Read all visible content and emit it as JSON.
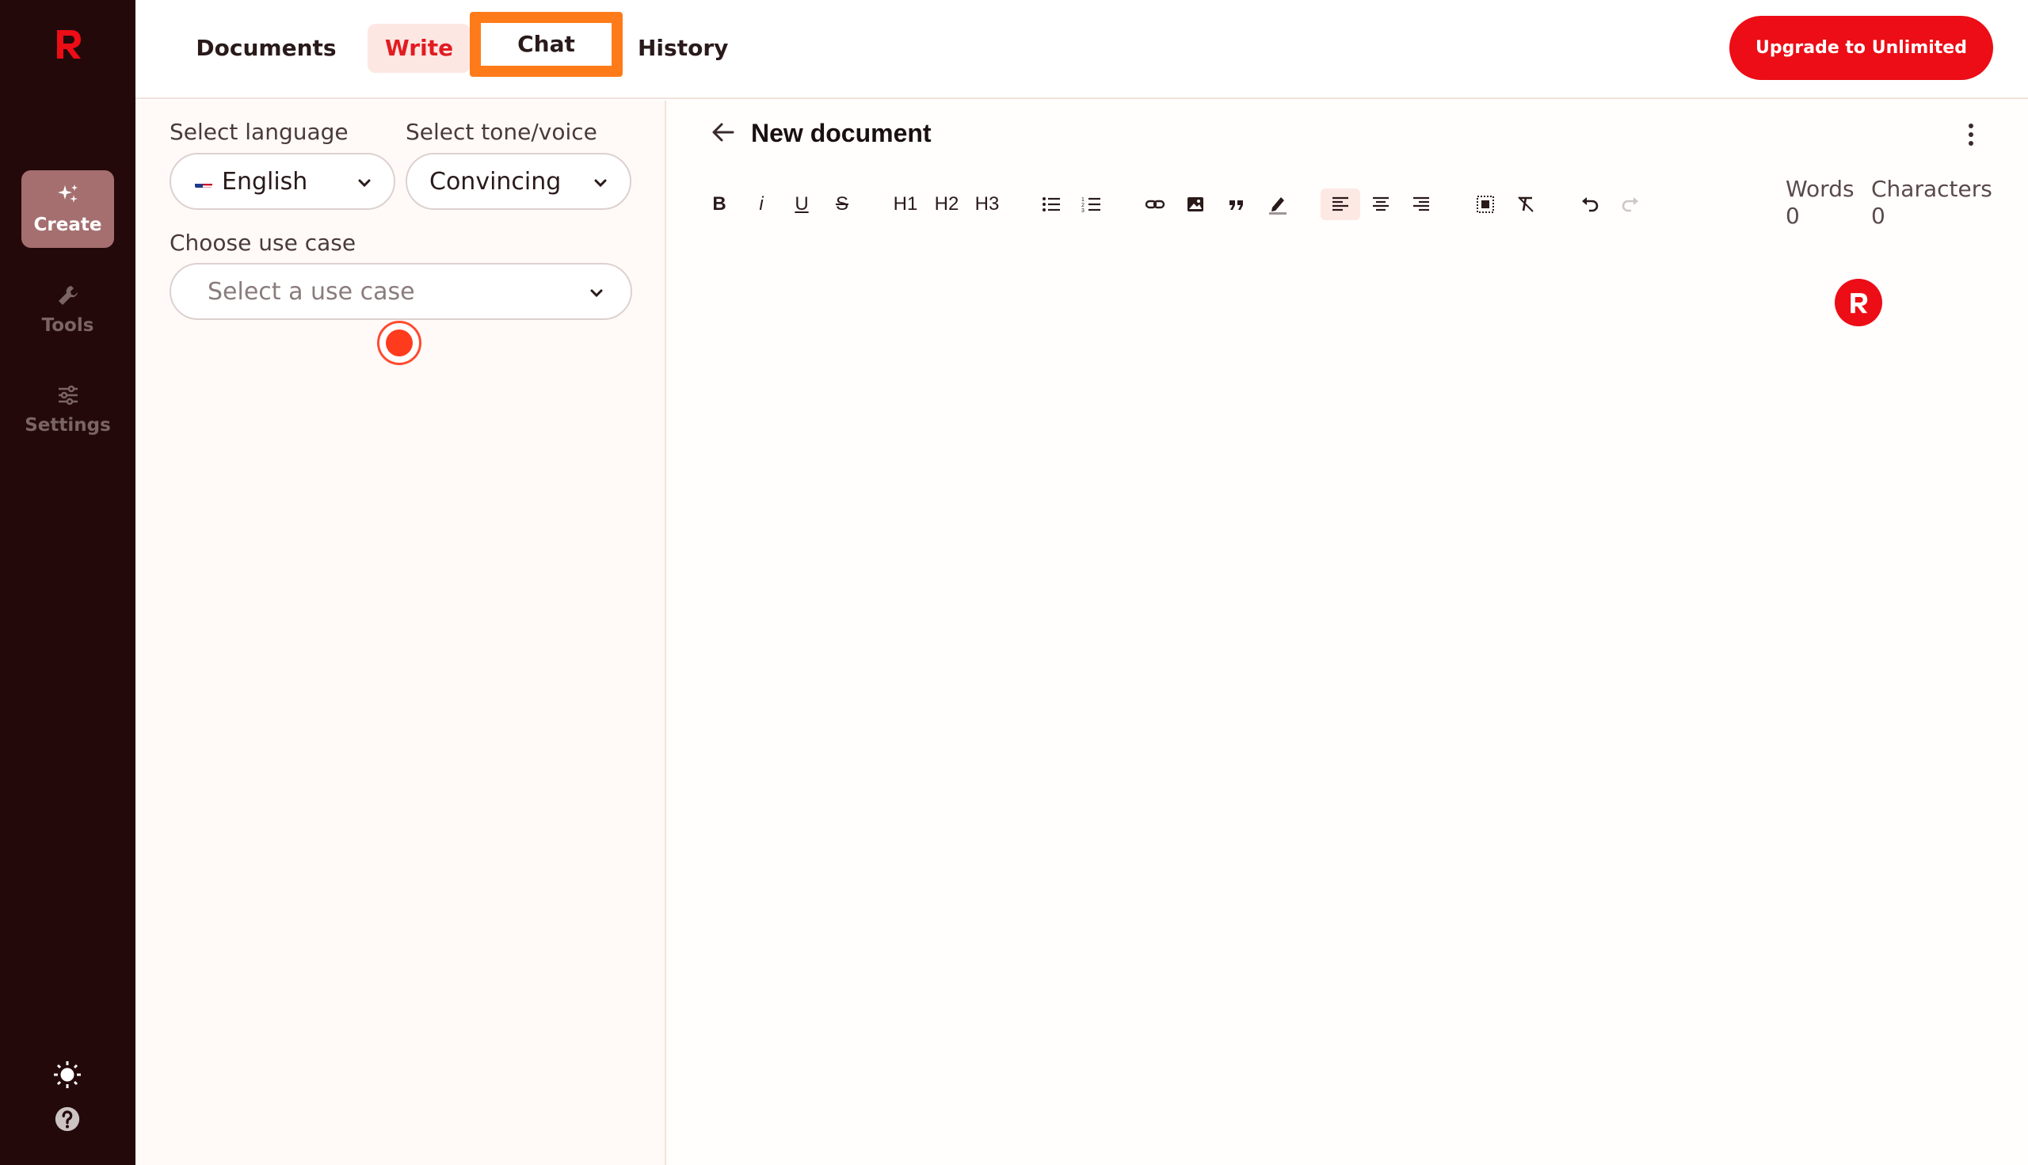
{
  "sidebar": {
    "items": [
      {
        "label": "Create",
        "icon": "sparkles-icon",
        "active": true
      },
      {
        "label": "Tools",
        "icon": "wrench-icon",
        "active": false
      },
      {
        "label": "Settings",
        "icon": "sliders-icon",
        "active": false
      }
    ],
    "bottom_icons": [
      "sun-icon",
      "help-icon"
    ]
  },
  "header": {
    "tabs": [
      {
        "label": "Documents"
      },
      {
        "label": "Write"
      },
      {
        "label": "Chat"
      },
      {
        "label": "History"
      }
    ],
    "upgrade_label": "Upgrade to Unlimited"
  },
  "form": {
    "language_label": "Select language",
    "language_value": "English",
    "tone_label": "Select tone/voice",
    "tone_value": "Convincing",
    "usecase_label": "Choose use case",
    "usecase_placeholder": "Select a use case"
  },
  "editor": {
    "title": "New document",
    "toolbar": {
      "bold": "B",
      "italic": "i",
      "underline": "U",
      "strike": "S",
      "h1": "H1",
      "h2": "H2",
      "h3": "H3"
    },
    "words_label": "Words",
    "words_value": "0",
    "chars_label": "Characters",
    "chars_value": "0"
  },
  "colors": {
    "brand_red": "#ec0d16",
    "sidebar_bg": "#24090b",
    "highlight_orange": "#ff7b1a"
  }
}
